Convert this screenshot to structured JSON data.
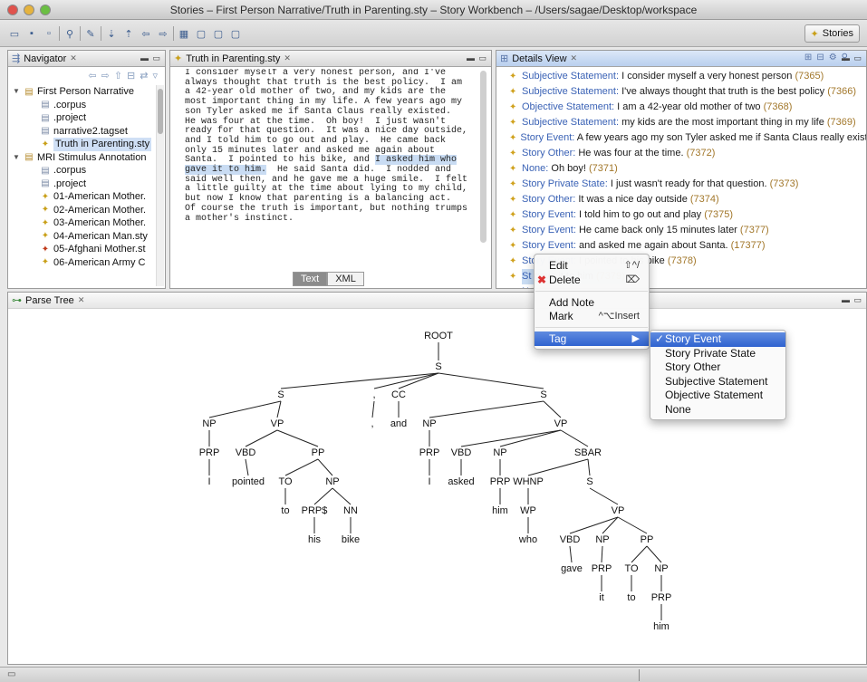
{
  "window": {
    "title": "Stories – First Person Narrative/Truth in Parenting.sty – Story Workbench – /Users/sagae/Desktop/workspace"
  },
  "perspective": {
    "label": "Stories"
  },
  "navigator": {
    "tab_label": "Navigator",
    "items": [
      {
        "label": "First Person Narrative",
        "level": 0,
        "kind": "project",
        "expanded": true
      },
      {
        "label": ".corpus",
        "level": 1,
        "kind": "file"
      },
      {
        "label": ".project",
        "level": 1,
        "kind": "file"
      },
      {
        "label": "narrative2.tagset",
        "level": 1,
        "kind": "file"
      },
      {
        "label": "Truth in Parenting.sty",
        "level": 1,
        "kind": "story",
        "selected": true
      },
      {
        "label": "MRI Stimulus Annotation",
        "level": 0,
        "kind": "project",
        "expanded": true
      },
      {
        "label": ".corpus",
        "level": 1,
        "kind": "file"
      },
      {
        "label": ".project",
        "level": 1,
        "kind": "file"
      },
      {
        "label": "01-American Mother.",
        "level": 1,
        "kind": "story"
      },
      {
        "label": "02-American Mother.",
        "level": 1,
        "kind": "story"
      },
      {
        "label": "03-American Mother.",
        "level": 1,
        "kind": "story"
      },
      {
        "label": "04-American Man.sty",
        "level": 1,
        "kind": "story"
      },
      {
        "label": "05-Afghani Mother.st",
        "level": 1,
        "kind": "story-red"
      },
      {
        "label": "06-American Army C",
        "level": 1,
        "kind": "story"
      }
    ]
  },
  "editor": {
    "tab_label": "Truth in Parenting.sty",
    "text_before": "I consider myself a very honest person, and I've\nalways thought that truth is the best policy.  I am\na 42-year old mother of two, and my kids are the\nmost important thing in my life. A few years ago my\nson Tyler asked me if Santa Claus really existed.\nHe was four at the time.  Oh boy!  I just wasn't\nready for that question.  It was a nice day outside,\nand I told him to go out and play.  He came back\nonly 15 minutes later and asked me again about\nSanta.  I pointed to his bike, and ",
    "text_highlight": "I asked him who\ngave it to him.",
    "text_after": "  He said Santa did.  I nodded and\nsaid well then, and he gave me a huge smile.  I felt\na little guilty at the time about lying to my child,\nbut now I know that parenting is a balancing act.\nOf course the truth is important, but nothing trumps\na mother's instinct.",
    "tabs": [
      "Text",
      "XML"
    ]
  },
  "details": {
    "tab_label": "Details View",
    "rows": [
      {
        "kind": "Subjective Statement:",
        "text": "I consider myself a very honest person",
        "id": "(7365)"
      },
      {
        "kind": "Subjective Statement:",
        "text": "I've always thought that truth is the best policy",
        "id": "(7366)"
      },
      {
        "kind": "Objective Statement:",
        "text": "I am a 42-year old mother of two",
        "id": "(7368)"
      },
      {
        "kind": "Subjective Statement:",
        "text": "my kids are the most important thing in my life",
        "id": "(7369)"
      },
      {
        "kind": "Story Event:",
        "text": "A few years ago my son Tyler asked me if Santa Claus really existe",
        "id": ""
      },
      {
        "kind": "Story Other:",
        "text": "He was four at the time.",
        "id": "(7372)"
      },
      {
        "kind": "None:",
        "text": "Oh boy!",
        "id": "(7371)"
      },
      {
        "kind": "Story Private State:",
        "text": "I just wasn't ready for that question.",
        "id": "(7373)"
      },
      {
        "kind": "Story Other:",
        "text": "It was a nice day outside",
        "id": "(7374)"
      },
      {
        "kind": "Story Event:",
        "text": "I told him to go out and play",
        "id": "(7375)"
      },
      {
        "kind": "Story Event:",
        "text": "He came back only 15 minutes later",
        "id": "(7377)"
      },
      {
        "kind": "Story Event:",
        "text": "and asked me again about Santa.",
        "id": "(17377)"
      },
      {
        "kind": "Story Event:",
        "text": "I pointed to his bike",
        "id": "(7378)"
      },
      {
        "kind": "St",
        "text": "gave it to him",
        "id": "(7379)",
        "selected": true
      },
      {
        "kind": "N",
        "text": "",
        "id": "31)"
      }
    ]
  },
  "parse_tree": {
    "tab_label": "Parse Tree",
    "nodes": [
      "ROOT",
      "S",
      "S",
      ",",
      "CC",
      "S",
      "NP",
      "VP",
      ",",
      "and",
      "NP",
      "VP",
      "PRP",
      "VBD",
      "PP",
      "PRP",
      "VBD",
      "NP",
      "SBAR",
      "I",
      "pointed",
      "TO",
      "NP",
      "I",
      "asked",
      "PRP",
      "WHNP",
      "S",
      "to",
      "PRP$",
      "NN",
      "him",
      "WP",
      "VP",
      "his",
      "bike",
      "who",
      "VBD",
      "NP",
      "PP",
      "gave",
      "PRP",
      "TO",
      "NP",
      "it",
      "to",
      "PRP",
      "him"
    ]
  },
  "context_menu": {
    "items": [
      {
        "label": "Edit",
        "shortcut": "⇧^/"
      },
      {
        "label": "Delete",
        "shortcut": "⌦"
      },
      {
        "label": "Add Note",
        "shortcut": ""
      },
      {
        "label": "Mark",
        "shortcut": "^⌥Insert"
      },
      {
        "label": "Tag",
        "shortcut": "▶"
      }
    ],
    "submenu": [
      "Story Event",
      "Story Private State",
      "Story Other",
      "Subjective Statement",
      "Objective Statement",
      "None"
    ],
    "checked_mark": "✓"
  },
  "colors": {
    "selection": "#c9dcf3",
    "menu_highlight": "#3a6fd6",
    "tag_kind": "#3a62b5",
    "tag_id": "#a2772a"
  }
}
